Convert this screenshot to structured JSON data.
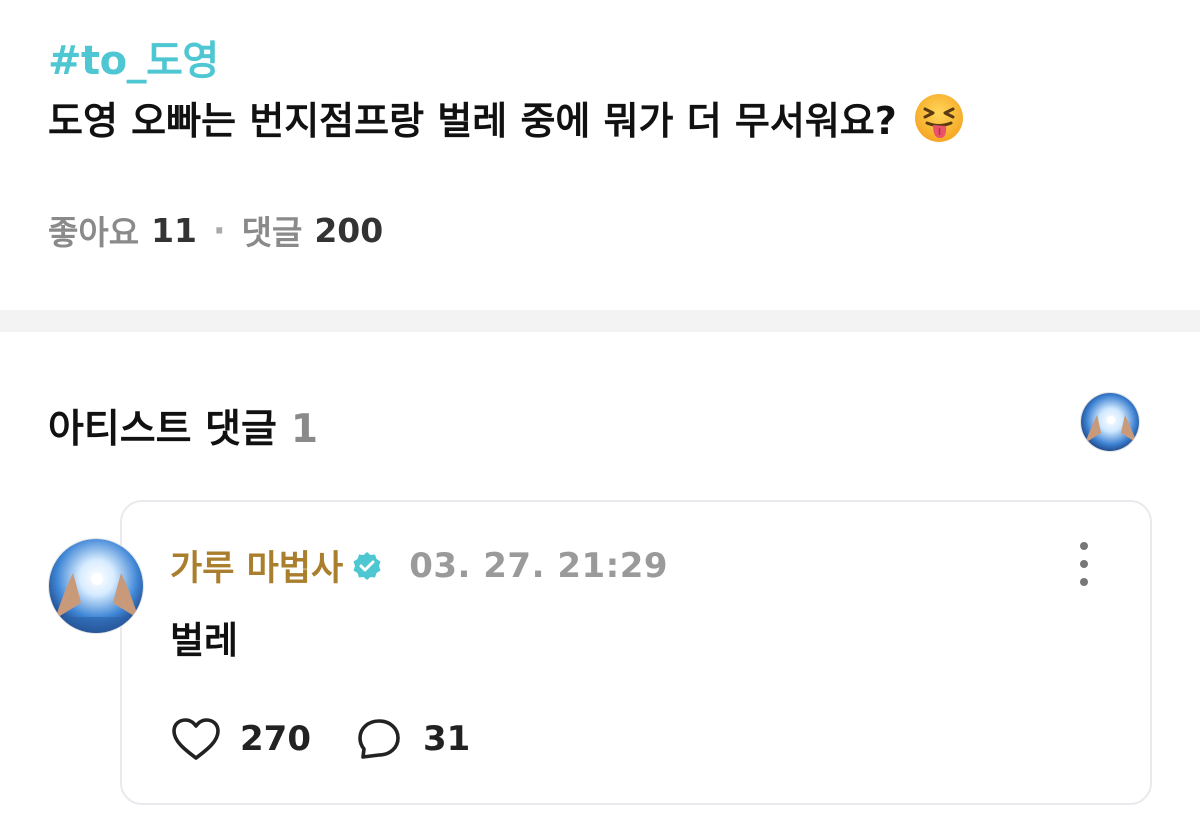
{
  "post": {
    "hashtag": "#to_도영",
    "question": "도영 오빠는 번지점프랑 벌레 중에 뭐가 더 무서워요?",
    "emoji": "squinting-face-with-tongue",
    "likes_label": "좋아요",
    "likes_count": "11",
    "separator": "·",
    "comments_label": "댓글",
    "comments_count": "200"
  },
  "artist_section": {
    "title": "아티스트 댓글",
    "count": "1"
  },
  "comment": {
    "author": "가루 마법사",
    "verified_icon": "verified-badge-icon",
    "timestamp": "03. 27. 21:29",
    "body": "벌레",
    "like_count": "270",
    "reply_count": "31"
  },
  "colors": {
    "hashtag": "#4fc7d3",
    "author": "#a97e2d",
    "verified": "#4fc7d3",
    "muted": "#8a8a8a",
    "divider": "#f3f3f3",
    "card_border": "#e9e9ee"
  }
}
